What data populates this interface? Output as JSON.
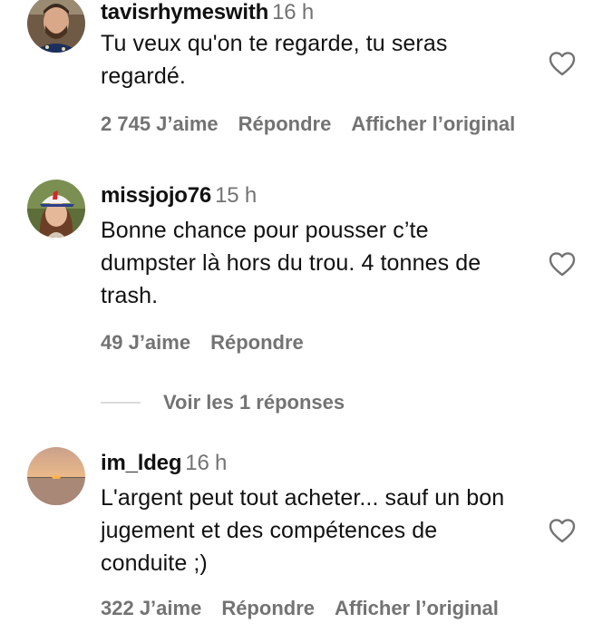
{
  "comments": [
    {
      "username": "tavisrhymeswith",
      "time": "16 h",
      "text": "Tu veux qu'on te regarde, tu seras regardé.",
      "likes": "2 745 J’aime",
      "reply": "Répondre",
      "translate": "Afficher l’original",
      "avatar_icon": "avatar-man-icon"
    },
    {
      "username": "missjojo76",
      "time": "15 h",
      "text": "Bonne chance pour pousser c’te dumpster là hors du trou. 4 tonnes de trash.",
      "likes": "49 J’aime",
      "reply": "Répondre",
      "avatar_icon": "avatar-woman-cap-icon"
    },
    {
      "username": "im_ldeg",
      "time": "16 h",
      "text": "L'argent peut tout acheter... sauf un bon jugement et des compétences de conduite ;)",
      "likes": "322 J’aime",
      "reply": "Répondre",
      "translate": "Afficher l’original",
      "avatar_icon": "avatar-sunset-icon"
    }
  ],
  "view_replies": "Voir les 1 réponses",
  "colors": {
    "text": "#111111",
    "muted": "#737373",
    "divider": "#dbdbdb",
    "heart_outline": "#737373"
  }
}
